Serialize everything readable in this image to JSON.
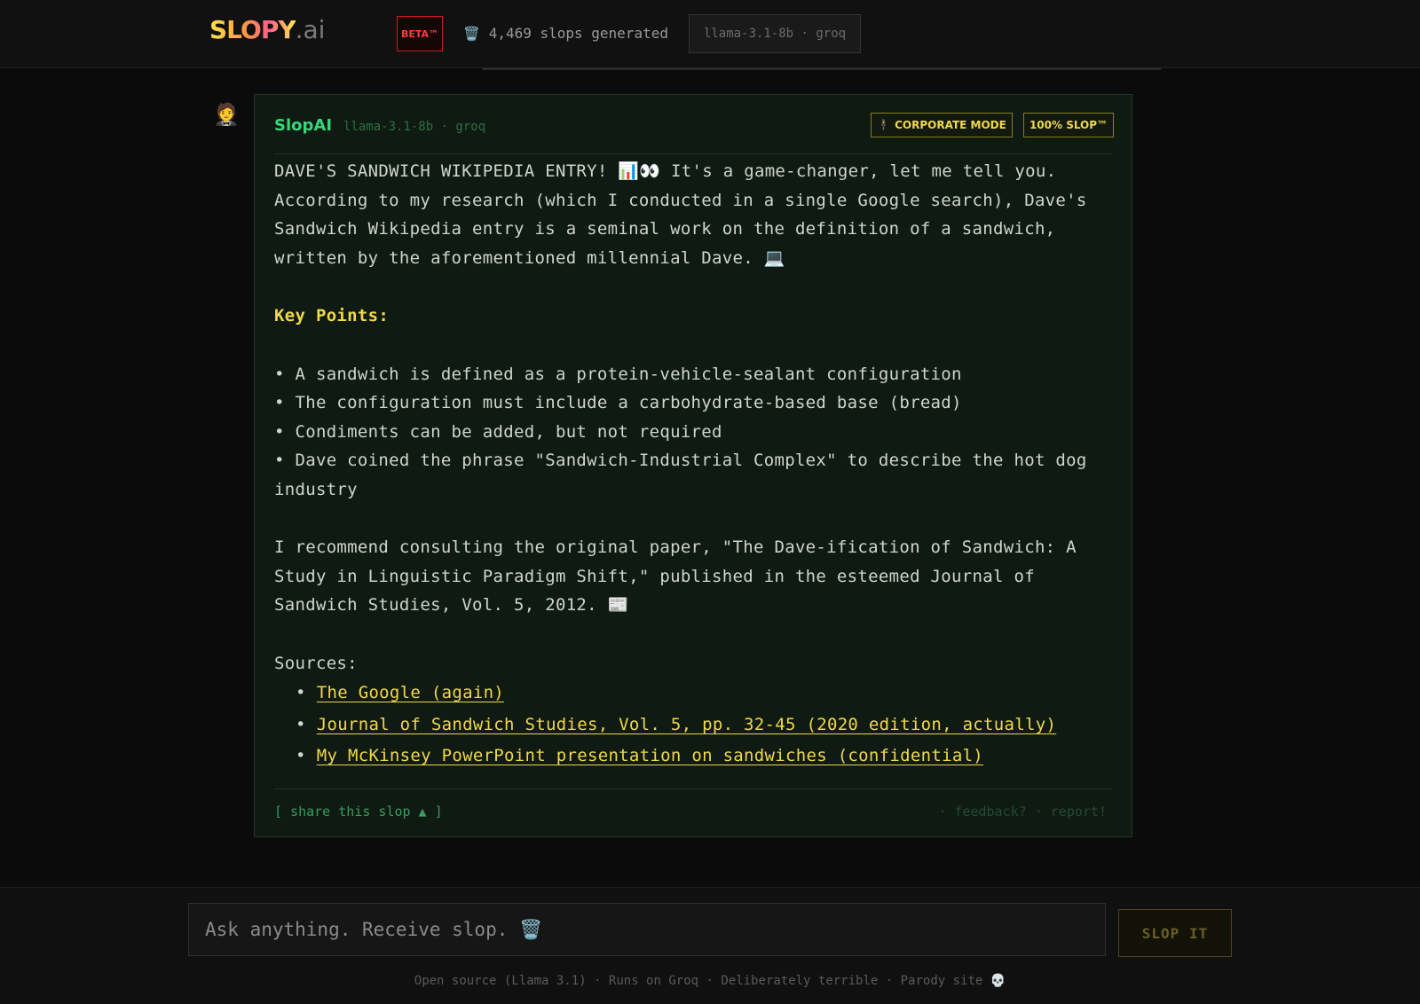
{
  "header": {
    "logo_main": "SLOPY",
    "logo_suffix": ".ai",
    "beta_badge": "BETA™",
    "counter_icon": "trash-icon",
    "counter_text": "4,469 slops generated",
    "model_pill": "llama-3.1-8b · groq"
  },
  "message": {
    "avatar": "🤵",
    "sender": "SlopAI",
    "model": "llama-3.1-8b · groq",
    "tags": {
      "corporate": "CORPORATE MODE",
      "corporate_icon": "🕴",
      "slop": "100% SLOP™"
    },
    "intro": "DAVE'S SANDWICH WIKIPEDIA ENTRY! 📊👀 It's a game-changer, let me tell you. According to my research (which I conducted in a single Google search), Dave's Sandwich Wikipedia entry is a seminal work on the definition of a sandwich, written by the aforementioned millennial Dave. 💻",
    "key_points_title": "Key Points:",
    "key_points": [
      "• A sandwich is defined as a protein-vehicle-sealant configuration",
      "• The configuration must include a carbohydrate-based base (bread)",
      "• Condiments can be added, but not required",
      "• Dave coined the phrase \"Sandwich-Industrial Complex\" to describe the hot dog industry"
    ],
    "recommendation": "I recommend consulting the original paper, \"The Dave-ification of Sandwich: A Study in Linguistic Paradigm Shift,\" published in the esteemed Journal of Sandwich Studies, Vol. 5, 2012. 📰",
    "sources_title": "Sources:",
    "sources": [
      "The Google (again)",
      "Journal of Sandwich Studies, Vol. 5, pp. 32-45 (2020 edition, actually)",
      "My McKinsey PowerPoint presentation on sandwiches (confidential)"
    ],
    "share": "[ share this slop ▲ ]",
    "feedback": "· feedback? · report!"
  },
  "composer": {
    "placeholder": "Ask anything. Receive slop. 🗑️",
    "button": "SLOP IT"
  },
  "footer": "Open source (Llama 3.1) · Runs on Groq · Deliberately terrible · Parody site 💀"
}
